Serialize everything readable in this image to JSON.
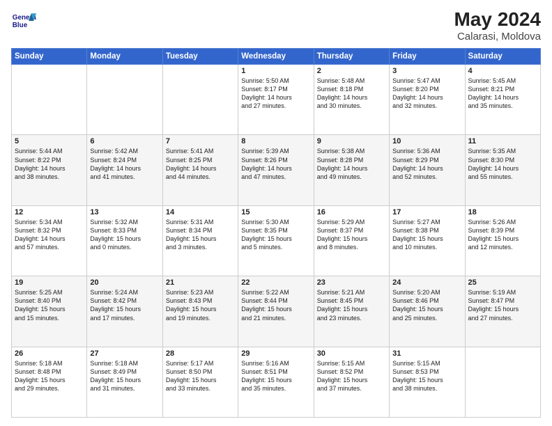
{
  "header": {
    "logo_line1": "General",
    "logo_line2": "Blue",
    "month_year": "May 2024",
    "location": "Calarasi, Moldova"
  },
  "days_of_week": [
    "Sunday",
    "Monday",
    "Tuesday",
    "Wednesday",
    "Thursday",
    "Friday",
    "Saturday"
  ],
  "weeks": [
    [
      {
        "day": "",
        "content": ""
      },
      {
        "day": "",
        "content": ""
      },
      {
        "day": "",
        "content": ""
      },
      {
        "day": "1",
        "content": "Sunrise: 5:50 AM\nSunset: 8:17 PM\nDaylight: 14 hours\nand 27 minutes."
      },
      {
        "day": "2",
        "content": "Sunrise: 5:48 AM\nSunset: 8:18 PM\nDaylight: 14 hours\nand 30 minutes."
      },
      {
        "day": "3",
        "content": "Sunrise: 5:47 AM\nSunset: 8:20 PM\nDaylight: 14 hours\nand 32 minutes."
      },
      {
        "day": "4",
        "content": "Sunrise: 5:45 AM\nSunset: 8:21 PM\nDaylight: 14 hours\nand 35 minutes."
      }
    ],
    [
      {
        "day": "5",
        "content": "Sunrise: 5:44 AM\nSunset: 8:22 PM\nDaylight: 14 hours\nand 38 minutes."
      },
      {
        "day": "6",
        "content": "Sunrise: 5:42 AM\nSunset: 8:24 PM\nDaylight: 14 hours\nand 41 minutes."
      },
      {
        "day": "7",
        "content": "Sunrise: 5:41 AM\nSunset: 8:25 PM\nDaylight: 14 hours\nand 44 minutes."
      },
      {
        "day": "8",
        "content": "Sunrise: 5:39 AM\nSunset: 8:26 PM\nDaylight: 14 hours\nand 47 minutes."
      },
      {
        "day": "9",
        "content": "Sunrise: 5:38 AM\nSunset: 8:28 PM\nDaylight: 14 hours\nand 49 minutes."
      },
      {
        "day": "10",
        "content": "Sunrise: 5:36 AM\nSunset: 8:29 PM\nDaylight: 14 hours\nand 52 minutes."
      },
      {
        "day": "11",
        "content": "Sunrise: 5:35 AM\nSunset: 8:30 PM\nDaylight: 14 hours\nand 55 minutes."
      }
    ],
    [
      {
        "day": "12",
        "content": "Sunrise: 5:34 AM\nSunset: 8:32 PM\nDaylight: 14 hours\nand 57 minutes."
      },
      {
        "day": "13",
        "content": "Sunrise: 5:32 AM\nSunset: 8:33 PM\nDaylight: 15 hours\nand 0 minutes."
      },
      {
        "day": "14",
        "content": "Sunrise: 5:31 AM\nSunset: 8:34 PM\nDaylight: 15 hours\nand 3 minutes."
      },
      {
        "day": "15",
        "content": "Sunrise: 5:30 AM\nSunset: 8:35 PM\nDaylight: 15 hours\nand 5 minutes."
      },
      {
        "day": "16",
        "content": "Sunrise: 5:29 AM\nSunset: 8:37 PM\nDaylight: 15 hours\nand 8 minutes."
      },
      {
        "day": "17",
        "content": "Sunrise: 5:27 AM\nSunset: 8:38 PM\nDaylight: 15 hours\nand 10 minutes."
      },
      {
        "day": "18",
        "content": "Sunrise: 5:26 AM\nSunset: 8:39 PM\nDaylight: 15 hours\nand 12 minutes."
      }
    ],
    [
      {
        "day": "19",
        "content": "Sunrise: 5:25 AM\nSunset: 8:40 PM\nDaylight: 15 hours\nand 15 minutes."
      },
      {
        "day": "20",
        "content": "Sunrise: 5:24 AM\nSunset: 8:42 PM\nDaylight: 15 hours\nand 17 minutes."
      },
      {
        "day": "21",
        "content": "Sunrise: 5:23 AM\nSunset: 8:43 PM\nDaylight: 15 hours\nand 19 minutes."
      },
      {
        "day": "22",
        "content": "Sunrise: 5:22 AM\nSunset: 8:44 PM\nDaylight: 15 hours\nand 21 minutes."
      },
      {
        "day": "23",
        "content": "Sunrise: 5:21 AM\nSunset: 8:45 PM\nDaylight: 15 hours\nand 23 minutes."
      },
      {
        "day": "24",
        "content": "Sunrise: 5:20 AM\nSunset: 8:46 PM\nDaylight: 15 hours\nand 25 minutes."
      },
      {
        "day": "25",
        "content": "Sunrise: 5:19 AM\nSunset: 8:47 PM\nDaylight: 15 hours\nand 27 minutes."
      }
    ],
    [
      {
        "day": "26",
        "content": "Sunrise: 5:18 AM\nSunset: 8:48 PM\nDaylight: 15 hours\nand 29 minutes."
      },
      {
        "day": "27",
        "content": "Sunrise: 5:18 AM\nSunset: 8:49 PM\nDaylight: 15 hours\nand 31 minutes."
      },
      {
        "day": "28",
        "content": "Sunrise: 5:17 AM\nSunset: 8:50 PM\nDaylight: 15 hours\nand 33 minutes."
      },
      {
        "day": "29",
        "content": "Sunrise: 5:16 AM\nSunset: 8:51 PM\nDaylight: 15 hours\nand 35 minutes."
      },
      {
        "day": "30",
        "content": "Sunrise: 5:15 AM\nSunset: 8:52 PM\nDaylight: 15 hours\nand 37 minutes."
      },
      {
        "day": "31",
        "content": "Sunrise: 5:15 AM\nSunset: 8:53 PM\nDaylight: 15 hours\nand 38 minutes."
      },
      {
        "day": "",
        "content": ""
      }
    ]
  ]
}
